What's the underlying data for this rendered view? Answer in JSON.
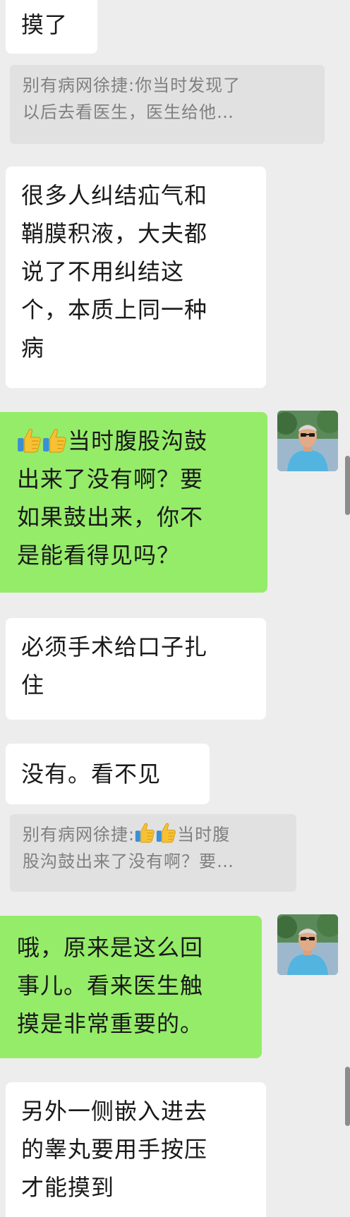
{
  "conversation": {
    "msg1": {
      "text": "摸了"
    },
    "quote1": {
      "line1": "别有病网徐捷:你当时发现了",
      "line2": "以后去看医生，医生给他…"
    },
    "msg2": {
      "lines": [
        "很多人纠结疝气和",
        "鞘膜积液，大夫都",
        "说了不用纠结这",
        "个，本质上同一种",
        "病"
      ]
    },
    "msg3": {
      "lines": [
        "当时腹股沟鼓",
        "出来了没有啊？要",
        "如果鼓出来，你不",
        "是能看得见吗？"
      ]
    },
    "msg4": {
      "lines": [
        "必须手术给口子扎",
        "住"
      ]
    },
    "msg5": {
      "text": "没有。看不见"
    },
    "quote2": {
      "line1_prefix": "别有病网徐捷:",
      "line1_suffix": "当时腹",
      "line2": "股沟鼓出来了没有啊？要…"
    },
    "msg6": {
      "lines": [
        "哦，原来是这么回",
        "事儿。看来医生触",
        "摸是非常重要的。"
      ]
    },
    "msg7": {
      "lines": [
        "另外一侧嵌入进去",
        "的睾丸要用手按压",
        "才能摸到"
      ]
    }
  },
  "icons": {
    "thumbs_up": "thumbs-up-emoji",
    "avatar": "user-avatar-photo"
  },
  "colors": {
    "background": "#ededed",
    "incoming_bubble": "#ffffff",
    "outgoing_bubble": "#95ec69",
    "quote_bg": "#e1e1e1",
    "quote_text": "#808080",
    "thumb_yellow": "#f6c134"
  }
}
